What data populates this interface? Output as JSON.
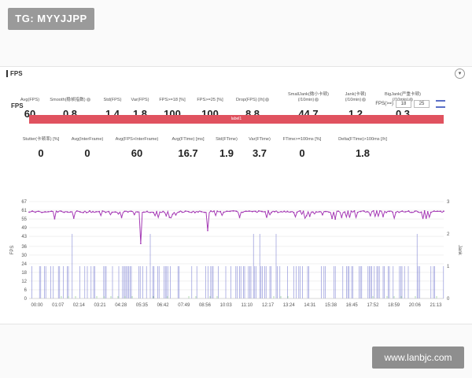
{
  "watermark_top": "TG: MYYJJPP",
  "watermark_bottom": "www.lanbjc.com",
  "section": {
    "title": "FPS"
  },
  "metrics_row1": [
    {
      "label": "Avg(FPS)",
      "value": "60",
      "help": false
    },
    {
      "label": "Smooth(稳帧指数)",
      "value": "0.8",
      "help": true
    },
    {
      "label": "Std(FPS)",
      "value": "1.4",
      "help": false
    },
    {
      "label": "Var(FPS)",
      "value": "1.8",
      "help": false
    },
    {
      "label": "FPS>=18 [%]",
      "value": "100",
      "help": false
    },
    {
      "label": "FPS>=25 [%]",
      "value": "100",
      "help": false
    },
    {
      "label": "Drop(FPS) [/h]",
      "value": "8.8",
      "help": true
    },
    {
      "label": "SmallJank(微小卡顿)\n(/10min)",
      "value": "44.7",
      "help": true
    },
    {
      "label": "Jank(卡顿)\n(/10min)",
      "value": "1.2",
      "help": true
    },
    {
      "label": "BigJank(严重卡顿)\n(/10min)",
      "value": "0.3",
      "help": true
    }
  ],
  "metrics_row2": [
    {
      "label": "Stutter(卡顿率) [%]",
      "value": "0",
      "help": false
    },
    {
      "label": "Avg(InterFrame)",
      "value": "0",
      "help": false
    },
    {
      "label": "Avg(FPS+InterFrame)",
      "value": "60",
      "help": false
    },
    {
      "label": "Avg(FTime) [ms]",
      "value": "16.7",
      "help": false
    },
    {
      "label": "Std(FTime)",
      "value": "1.9",
      "help": false
    },
    {
      "label": "Var(FTime)",
      "value": "3.7",
      "help": false
    },
    {
      "label": "FTime>=100ms [%]",
      "value": "0",
      "help": false
    },
    {
      "label": "Delta(FTime)>100ms [/h]",
      "value": "1.8",
      "help": false
    }
  ],
  "chart_section": {
    "title": "FPS",
    "threshold_label": "FPS(>=)",
    "threshold_1": "18",
    "threshold_2": "25",
    "label_bar": "label1"
  },
  "chart_data": {
    "type": "line",
    "ylabel": "FPS",
    "y2label": "Jank",
    "y_ticks": [
      "0",
      "6",
      "12",
      "18",
      "24",
      "30",
      "36",
      "43",
      "49",
      "55",
      "61",
      "67"
    ],
    "ylim": [
      0,
      67
    ],
    "y2_ticks": [
      "0",
      "1",
      "2",
      "3"
    ],
    "y2lim": [
      0,
      3
    ],
    "x_ticks": [
      "00:00",
      "01:07",
      "02:14",
      "03:21",
      "04:28",
      "05:35",
      "06:42",
      "07:49",
      "08:56",
      "10:03",
      "11:10",
      "12:17",
      "13:24",
      "14:31",
      "15:38",
      "16:45",
      "17:52",
      "18:59",
      "20:06",
      "21:13"
    ],
    "series": [
      {
        "name": "FPS",
        "color": "#a53bb5",
        "baseline": 60,
        "dips": [
          {
            "at": 0.27,
            "value": 38
          },
          {
            "at": 0.43,
            "value": 47
          },
          {
            "at": 0.95,
            "value": 55
          }
        ]
      },
      {
        "name": "Jank",
        "color": "#5a5fc7"
      }
    ]
  },
  "colors": {
    "fps_line": "#a53bb5",
    "jank_bars": "#5a5fc7",
    "label_bar": "#e0525f",
    "grid": "#e8e8e8"
  }
}
